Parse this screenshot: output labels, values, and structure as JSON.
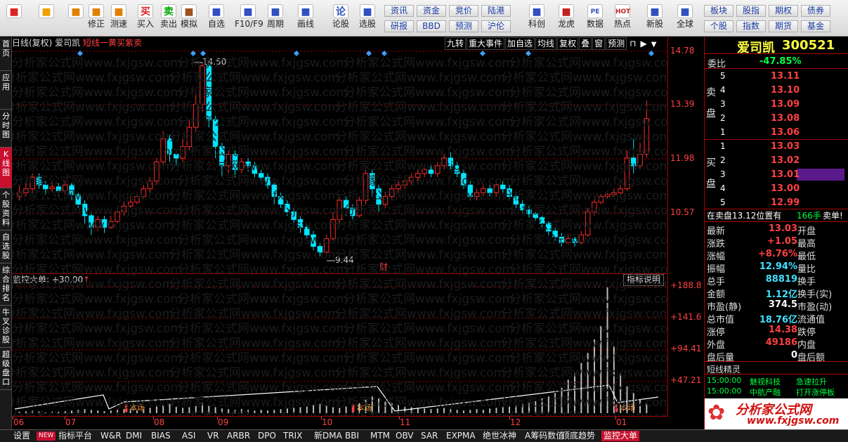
{
  "toolbar": {
    "buttons": [
      {
        "label": "",
        "icon": "grid-logo-icon"
      },
      {
        "label": "",
        "icon": "back-arrow-icon"
      },
      {
        "label": "",
        "icon": "up-down-arrows-icon"
      },
      {
        "label": "修正",
        "icon": "refresh-icon"
      },
      {
        "label": "测速",
        "icon": "clock-icon"
      },
      {
        "label": "买入",
        "icon": "buy-icon",
        "glyph": "买"
      },
      {
        "label": "卖出",
        "icon": "sell-icon",
        "glyph": "卖"
      },
      {
        "label": "模拟",
        "icon": "hammer-icon"
      },
      {
        "label": "自选",
        "icon": "star-folder-icon"
      },
      {
        "label": "F10/F9",
        "icon": "f10-icon"
      },
      {
        "label": "周期",
        "icon": "period-icon"
      },
      {
        "label": "画线",
        "icon": "pencil-icon"
      },
      {
        "label": "论股",
        "icon": "discuss-icon",
        "glyph": "论"
      },
      {
        "label": "选股",
        "icon": "chart-search-icon"
      },
      {
        "label": "科创",
        "icon": "kechuang-icon"
      },
      {
        "label": "龙虎",
        "icon": "dragon-icon"
      },
      {
        "label": "数据",
        "icon": "pe-icon",
        "glyph": "PE"
      },
      {
        "label": "热点",
        "icon": "hot-icon",
        "glyph": "HOT"
      },
      {
        "label": "新股",
        "icon": "newstock-icon"
      },
      {
        "label": "全球",
        "icon": "globe-icon"
      }
    ],
    "quick_row1": [
      "资讯",
      "资金",
      "竞价",
      "陆港"
    ],
    "quick_row2": [
      "研报",
      "BBD",
      "预测",
      "沪伦"
    ],
    "quick_right_row1": [
      "板块",
      "股指",
      "期权",
      "债券"
    ],
    "quick_right_row2": [
      "个股",
      "指数",
      "期货",
      "基金"
    ]
  },
  "left_nav": [
    "首页",
    "应用",
    "分时图",
    "K线图",
    "个股资料",
    "自选股",
    "综合排名",
    "牛叉诊股",
    "超级盘口"
  ],
  "chart": {
    "header_period": "日线(复权)",
    "header_name": "爱司凯",
    "header_indicator": "短线一黄买紫卖",
    "toolbar_items": [
      "九转",
      "重大事件",
      "加自选",
      "均线",
      "复权",
      "叠",
      "窗",
      "预测"
    ],
    "high_label": "14.50",
    "low_label": "9.44",
    "cai_label": "财",
    "sub_title": "监控大单: +30.00",
    "sub_arrow": "↑",
    "indicator_help": "指标说明",
    "benchang_label": "本场"
  },
  "chart_data": {
    "type": "candlestick",
    "y_ticks_main": [
      14.78,
      13.39,
      11.98,
      10.57
    ],
    "y_ticks_sub": [
      "188.8",
      "141.6",
      "94.41",
      "47.21"
    ],
    "x_tick_labels": [
      "06",
      "07",
      "08",
      "09",
      "10",
      "11",
      "12",
      "01"
    ],
    "main_ylim": [
      9.2,
      14.78
    ],
    "sub_ylim": [
      0,
      188.8
    ],
    "candles": [
      [
        11.0,
        11.1,
        11.3,
        10.9
      ],
      [
        11.1,
        11.2,
        11.35,
        11.0
      ],
      [
        11.2,
        11.5,
        11.6,
        11.1
      ],
      [
        11.5,
        11.3,
        11.6,
        11.2
      ],
      [
        11.3,
        11.2,
        11.4,
        11.05
      ],
      [
        11.2,
        11.25,
        11.4,
        11.1
      ],
      [
        11.25,
        11.15,
        11.35,
        11.0
      ],
      [
        11.15,
        11.3,
        11.4,
        11.05
      ],
      [
        11.3,
        11.05,
        11.35,
        10.9
      ],
      [
        11.05,
        10.8,
        11.1,
        10.7
      ],
      [
        10.8,
        10.5,
        10.9,
        10.3
      ],
      [
        10.5,
        10.2,
        10.6,
        10.0
      ],
      [
        10.2,
        10.4,
        10.5,
        10.1
      ],
      [
        10.4,
        10.2,
        10.5,
        10.05
      ],
      [
        10.2,
        10.35,
        10.5,
        10.15
      ],
      [
        10.35,
        10.6,
        10.7,
        10.3
      ],
      [
        10.6,
        10.75,
        10.85,
        10.5
      ],
      [
        10.75,
        10.85,
        11.0,
        10.7
      ],
      [
        10.85,
        11.0,
        11.1,
        10.8
      ],
      [
        11.0,
        11.2,
        11.3,
        10.95
      ],
      [
        11.2,
        11.4,
        11.5,
        11.1
      ],
      [
        11.4,
        11.9,
        12.0,
        11.3
      ],
      [
        11.9,
        12.5,
        12.7,
        11.8
      ],
      [
        12.5,
        12.1,
        12.6,
        11.9
      ],
      [
        12.1,
        12.0,
        12.2,
        11.8
      ],
      [
        12.0,
        12.3,
        12.5,
        11.9
      ],
      [
        12.3,
        12.8,
        13.0,
        12.2
      ],
      [
        12.8,
        13.4,
        13.7,
        12.7
      ],
      [
        13.4,
        14.4,
        14.5,
        13.2
      ],
      [
        14.4,
        13.0,
        14.45,
        12.8
      ],
      [
        13.0,
        12.3,
        13.1,
        12.0
      ],
      [
        12.3,
        11.8,
        12.4,
        11.5
      ],
      [
        11.8,
        12.1,
        12.2,
        11.6
      ],
      [
        12.1,
        11.7,
        12.2,
        11.5
      ],
      [
        11.7,
        11.9,
        12.0,
        11.6
      ],
      [
        11.9,
        11.8,
        12.0,
        11.65
      ],
      [
        11.8,
        11.6,
        11.9,
        11.5
      ],
      [
        11.6,
        11.5,
        11.7,
        11.35
      ],
      [
        11.5,
        11.3,
        11.6,
        11.2
      ],
      [
        11.3,
        11.0,
        11.35,
        10.8
      ],
      [
        11.0,
        10.8,
        11.1,
        10.7
      ],
      [
        10.8,
        10.6,
        10.9,
        10.5
      ],
      [
        10.6,
        10.4,
        10.7,
        10.3
      ],
      [
        10.4,
        10.2,
        10.5,
        10.05
      ],
      [
        10.2,
        10.0,
        10.3,
        9.9
      ],
      [
        10.0,
        9.7,
        10.1,
        9.6
      ],
      [
        9.7,
        9.55,
        9.8,
        9.44
      ],
      [
        9.55,
        9.9,
        10.0,
        9.5
      ],
      [
        9.9,
        10.4,
        10.6,
        9.85
      ],
      [
        10.4,
        10.9,
        11.0,
        10.3
      ],
      [
        10.9,
        10.7,
        11.0,
        10.5
      ],
      [
        10.7,
        10.5,
        10.8,
        10.4
      ],
      [
        10.5,
        10.9,
        11.0,
        10.45
      ],
      [
        10.9,
        11.6,
        11.7,
        10.8
      ],
      [
        11.6,
        11.2,
        11.7,
        11.0
      ],
      [
        11.2,
        10.8,
        11.3,
        10.6
      ],
      [
        10.8,
        11.0,
        11.1,
        10.7
      ],
      [
        11.0,
        11.2,
        11.3,
        10.9
      ],
      [
        11.2,
        11.3,
        11.4,
        11.1
      ],
      [
        11.3,
        11.4,
        11.5,
        11.2
      ],
      [
        11.4,
        11.5,
        11.6,
        11.3
      ],
      [
        11.5,
        11.6,
        11.7,
        11.4
      ],
      [
        11.6,
        11.7,
        11.8,
        11.5
      ],
      [
        11.7,
        11.6,
        11.8,
        11.5
      ],
      [
        11.6,
        11.8,
        11.9,
        11.5
      ],
      [
        11.8,
        12.0,
        12.1,
        11.7
      ],
      [
        12.0,
        11.8,
        12.15,
        11.7
      ],
      [
        11.8,
        11.6,
        11.9,
        11.5
      ],
      [
        11.6,
        11.3,
        11.7,
        11.2
      ],
      [
        11.3,
        11.0,
        11.4,
        10.9
      ],
      [
        11.0,
        11.1,
        11.2,
        10.9
      ],
      [
        11.1,
        11.2,
        11.3,
        11.0
      ],
      [
        11.2,
        11.1,
        11.3,
        11.0
      ],
      [
        11.1,
        11.3,
        11.4,
        11.0
      ],
      [
        11.3,
        11.2,
        11.4,
        11.1
      ],
      [
        11.2,
        11.0,
        11.3,
        10.9
      ],
      [
        11.0,
        10.8,
        11.1,
        10.7
      ],
      [
        10.8,
        10.65,
        10.9,
        10.55
      ],
      [
        10.65,
        10.55,
        10.75,
        10.45
      ],
      [
        10.55,
        10.45,
        10.6,
        10.35
      ],
      [
        10.45,
        10.3,
        10.5,
        10.2
      ],
      [
        10.3,
        10.1,
        10.35,
        10.0
      ],
      [
        10.1,
        9.95,
        10.2,
        9.85
      ],
      [
        9.95,
        9.8,
        10.05,
        9.7
      ],
      [
        9.8,
        9.9,
        10.0,
        9.75
      ],
      [
        9.9,
        9.8,
        9.95,
        9.7
      ],
      [
        9.8,
        10.0,
        10.1,
        9.75
      ],
      [
        10.0,
        10.6,
        10.7,
        9.95
      ],
      [
        10.6,
        10.85,
        10.95,
        10.5
      ],
      [
        10.85,
        11.0,
        11.05,
        10.8
      ],
      [
        11.0,
        11.05,
        11.1,
        10.95
      ],
      [
        11.05,
        11.1,
        11.2,
        11.0
      ],
      [
        11.1,
        11.2,
        11.3,
        11.05
      ],
      [
        11.2,
        12.0,
        12.2,
        11.15
      ],
      [
        12.0,
        11.8,
        12.5,
        11.6
      ],
      [
        11.8,
        12.1,
        12.4,
        11.7
      ],
      [
        12.1,
        13.03,
        13.5,
        12.0
      ]
    ],
    "sub_bars": [
      2,
      3,
      4,
      3,
      2,
      3,
      2,
      3,
      4,
      5,
      6,
      5,
      4,
      3,
      4,
      5,
      6,
      5,
      4,
      6,
      8,
      10,
      12,
      14,
      10,
      8,
      9,
      11,
      15,
      12,
      9,
      7,
      6,
      5,
      6,
      5,
      4,
      5,
      4,
      5,
      6,
      7,
      8,
      9,
      10,
      12,
      14,
      11,
      9,
      8,
      10,
      12,
      15,
      20,
      25,
      22,
      18,
      15,
      12,
      10,
      9,
      8,
      7,
      6,
      7,
      8,
      6,
      5,
      4,
      5,
      6,
      5,
      7,
      8,
      9,
      10,
      12,
      14,
      16,
      18,
      22,
      25,
      30,
      38,
      50,
      60,
      75,
      90,
      110,
      130,
      188,
      100,
      60,
      40,
      30,
      20,
      15
    ]
  },
  "quote": {
    "name": "爱司凯",
    "code": "300521",
    "weibi_label": "委比",
    "weibi_value": "-47.85%",
    "sell_label": "卖盘",
    "buy_label": "买盘",
    "sell": [
      [
        "5",
        "13.11"
      ],
      [
        "4",
        "13.10"
      ],
      [
        "3",
        "13.09"
      ],
      [
        "2",
        "13.08"
      ],
      [
        "1",
        "13.06"
      ]
    ],
    "buy": [
      [
        "1",
        "13.03"
      ],
      [
        "2",
        "13.02"
      ],
      [
        "3",
        "13.01"
      ],
      [
        "4",
        "13.00"
      ],
      [
        "5",
        "12.99"
      ]
    ],
    "notice_prefix": "在卖盘13.12位置有",
    "notice_hands": "166手",
    "notice_suffix": "卖单!",
    "stats": [
      {
        "l": "最新",
        "v": "13.03",
        "r": "开盘"
      },
      {
        "l": "涨跌",
        "v": "+1.05",
        "r": "最高"
      },
      {
        "l": "涨幅",
        "v": "+8.76%",
        "r": "最低"
      },
      {
        "l": "振幅",
        "v": "12.94%",
        "r": "量比"
      },
      {
        "l": "总手",
        "v": "88819",
        "r": "换手"
      },
      {
        "l": "金额",
        "v": "1.12亿",
        "r": "换手(实)"
      },
      {
        "l": "市盈(静)",
        "v": "374.5",
        "r": "市盈(动)"
      },
      {
        "l": "总市值",
        "v": "18.76亿",
        "r": "流通值"
      },
      {
        "l": "涨停",
        "v": "14.38",
        "r": "跌停"
      },
      {
        "l": "外盘",
        "v": "49186",
        "r": "内盘"
      },
      {
        "l": "盘后量",
        "v": "0",
        "r": "盘后额"
      }
    ],
    "elf_title": "短线精灵",
    "elf": [
      {
        "t": "15:00:00",
        "n": "魅视科技",
        "e": "急速拉升"
      },
      {
        "t": "15:00:00",
        "n": "中航产融",
        "e": "打开涨停板"
      },
      {
        "t": "15:00:00",
        "n": "",
        "e": ""
      }
    ],
    "brand": "分析家公式网",
    "brand_url": "www.fxjgsw.com"
  },
  "tabs": [
    "设置",
    "NEW",
    "指标平台",
    "W&R",
    "DMI",
    "BIAS",
    "ASI",
    "VR",
    "ARBR",
    "DPO",
    "TRIX",
    "新DMA",
    "BBI",
    "MTM",
    "OBV",
    "SAR",
    "EXPMA",
    "绝世冰神",
    "A筹码数值",
    "顶底趋势",
    "监控大单"
  ],
  "watermark": "分析家公式网www.fxjgsw.com",
  "colors": {
    "up": "#ff2a2a",
    "down": "#00e5ff",
    "grid": "#a00000",
    "diamond": "#3aa0ff"
  }
}
